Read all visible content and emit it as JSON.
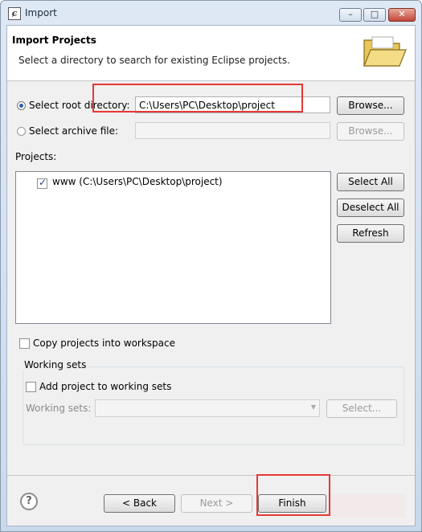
{
  "window": {
    "title": "Import",
    "min_glyph": "–",
    "max_glyph": "□",
    "close_glyph": "✕"
  },
  "header": {
    "title": "Import Projects",
    "description": "Select a directory to search for existing Eclipse projects."
  },
  "root_directory": {
    "radio_label": "Select root directory:",
    "value": "C:\\Users\\PC\\Desktop\\project",
    "browse_label": "Browse...",
    "selected": true
  },
  "archive_file": {
    "radio_label": "Select archive file:",
    "value": "",
    "browse_label": "Browse...",
    "selected": false
  },
  "projects": {
    "label": "Projects:",
    "items": [
      {
        "label": "www (C:\\Users\\PC\\Desktop\\project)",
        "checked": true
      }
    ],
    "select_all_label": "Select All",
    "deselect_all_label": "Deselect All",
    "refresh_label": "Refresh"
  },
  "copy_projects": {
    "label": "Copy projects into workspace",
    "checked": false
  },
  "working_sets": {
    "group_label": "Working sets",
    "add_label": "Add project to working sets",
    "add_checked": false,
    "field_label": "Working sets:",
    "value": "",
    "select_label": "Select..."
  },
  "footer": {
    "help_glyph": "?",
    "back_label": "< Back",
    "next_label": "Next >",
    "finish_label": "Finish"
  },
  "colors": {
    "highlight_box": "#e53935",
    "accent": "#2b5ea8"
  }
}
